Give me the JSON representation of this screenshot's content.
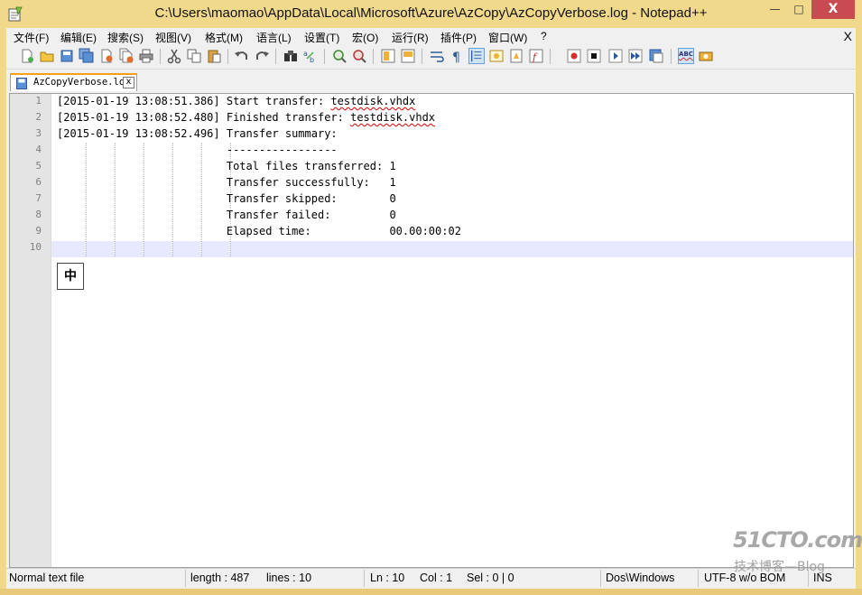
{
  "window": {
    "title": "C:\\Users\\maomao\\AppData\\Local\\Microsoft\\Azure\\AzCopy\\AzCopyVerbose.log - Notepad++",
    "minimize": "—",
    "maximize": "□",
    "close": "X"
  },
  "menu": {
    "items": [
      "文件(F)",
      "编辑(E)",
      "搜索(S)",
      "视图(V)",
      "格式(M)",
      "语言(L)",
      "设置(T)",
      "宏(O)",
      "运行(R)",
      "插件(P)",
      "窗口(W)",
      "?"
    ],
    "close": "X"
  },
  "toolbar": {
    "buttons": [
      "new-file-icon",
      "open-file-icon",
      "save-icon",
      "save-all-icon",
      "close-icon",
      "close-all-icon",
      "print-icon",
      "cut-icon",
      "copy-icon",
      "paste-icon",
      "undo-icon",
      "redo-icon",
      "find-icon",
      "replace-icon",
      "zoom-in-icon",
      "zoom-out-icon",
      "sync-vertical-icon",
      "sync-horizontal-icon",
      "word-wrap-icon",
      "show-all-characters-icon",
      "indent-guide-icon",
      "user-language-icon",
      "document-map-icon",
      "function-list-icon",
      "record-macro-icon",
      "stop-recording-icon",
      "playback-macro-icon",
      "run-macro-multiple-icon",
      "save-macro-icon",
      "spell-check-icon",
      "extra-icon"
    ],
    "active": [
      "indent-guide-icon",
      "spell-check-icon"
    ],
    "spell_check_label": "ABC"
  },
  "tab": {
    "label": "AzCopyVerbose.log",
    "close": "x"
  },
  "editor": {
    "line_numbers": [
      "1",
      "2",
      "3",
      "4",
      "5",
      "6",
      "7",
      "8",
      "9",
      "10"
    ],
    "lines": [
      {
        "pre": "[2015-01-19 13:08:51.386] Start transfer: ",
        "spell": "testdisk.vhdx"
      },
      {
        "pre": "[2015-01-19 13:08:52.480] Finished transfer: ",
        "spell": "testdisk.vhdx"
      },
      {
        "pre": "[2015-01-19 13:08:52.496] Transfer summary:",
        "spell": ""
      },
      {
        "pre": "                          -----------------",
        "spell": ""
      },
      {
        "pre": "                          Total files transferred: 1",
        "spell": ""
      },
      {
        "pre": "                          Transfer successfully:   1",
        "spell": ""
      },
      {
        "pre": "                          Transfer skipped:        0",
        "spell": ""
      },
      {
        "pre": "                          Transfer failed:         0",
        "spell": ""
      },
      {
        "pre": "                          Elapsed time:            00.00:00:02",
        "spell": ""
      },
      {
        "pre": "",
        "spell": ""
      }
    ],
    "current_line": 10,
    "current_line_color": "#e8e8ff",
    "ime_indicator": "中"
  },
  "status": {
    "file_type": "Normal text file",
    "length": "length : 487",
    "lines": "lines : 10",
    "ln": "Ln : 10",
    "col": "Col : 1",
    "sel": "Sel : 0 | 0",
    "eol": "Dos\\Windows",
    "encoding": "UTF-8 w/o BOM",
    "mode": "INS"
  },
  "watermark": {
    "main": "51CTO.com",
    "sub": "技术博客—Blog"
  },
  "colors": {
    "titlebar": "#f1d98c",
    "close_button": "#c74b50",
    "tab_accent": "#fa9e1b",
    "spell_underline": "#e00000"
  }
}
